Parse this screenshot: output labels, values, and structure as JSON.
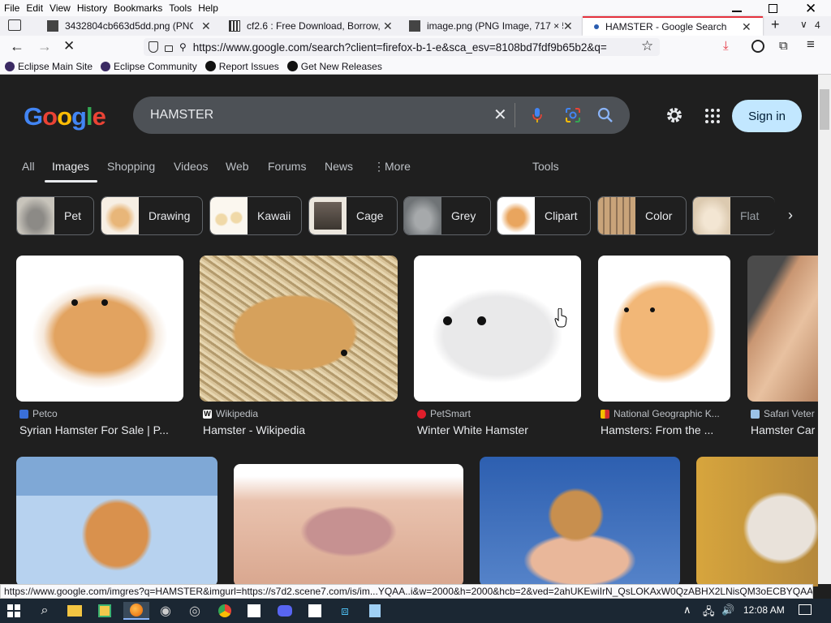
{
  "menu": [
    "File",
    "Edit",
    "View",
    "History",
    "Bookmarks",
    "Tools",
    "Help"
  ],
  "tabs": [
    {
      "title": "3432804cb663d5dd.png (PNG Ir",
      "active": false
    },
    {
      "title": "cf2.6 : Free Download, Borrow, a",
      "active": false
    },
    {
      "title": "image.png (PNG Image, 717 × 5",
      "active": false
    },
    {
      "title": "HAMSTER - Google Search",
      "active": true
    }
  ],
  "tab_count": "4",
  "url": "https://www.google.com/search?client=firefox-b-1-e&sca_esv=8108bd7fdf9b65b2&q=",
  "bookmarks": [
    "Eclipse Main Site",
    "Eclipse Community",
    "Report Issues",
    "Get New Releases"
  ],
  "google": {
    "query": "HAMSTER",
    "signin": "Sign in",
    "tabs": [
      "All",
      "Images",
      "Shopping",
      "Videos",
      "Web",
      "Forums",
      "News",
      "More",
      "Tools"
    ],
    "selected_tab": "Images"
  },
  "chips": [
    "Pet",
    "Drawing",
    "Kawaii",
    "Cage",
    "Grey",
    "Clipart",
    "Color",
    "Flat"
  ],
  "results": [
    {
      "source": "Petco",
      "title": "Syrian Hamster For Sale | P...",
      "fav_color": "#3a6fd8"
    },
    {
      "source": "Wikipedia",
      "title": "Hamster - Wikipedia",
      "fav_color": "#ffffff"
    },
    {
      "source": "PetSmart",
      "title": "Winter White Hamster",
      "fav_color": "#e01e2b"
    },
    {
      "source": "National Geographic K...",
      "title": "Hamsters: From the ...",
      "fav_color": "#f2c100"
    },
    {
      "source": "Safari Veter",
      "title": "Hamster Car",
      "fav_color": "#9bc2e6"
    }
  ],
  "status_url": "https://www.google.com/imgres?q=HAMSTER&imgurl=https://s7d2.scene7.com/is/im...YQAA..i&w=2000&h=2000&hcb=2&ved=2ahUKEwiIrN_QsLOKAxW0QzABHX2LNisQM3oECBYQAA",
  "clock": "12:08 AM",
  "colors": {
    "accent": "#e5323e",
    "signin_bg": "#c2e7ff",
    "page_bg": "#1f1f1f"
  }
}
